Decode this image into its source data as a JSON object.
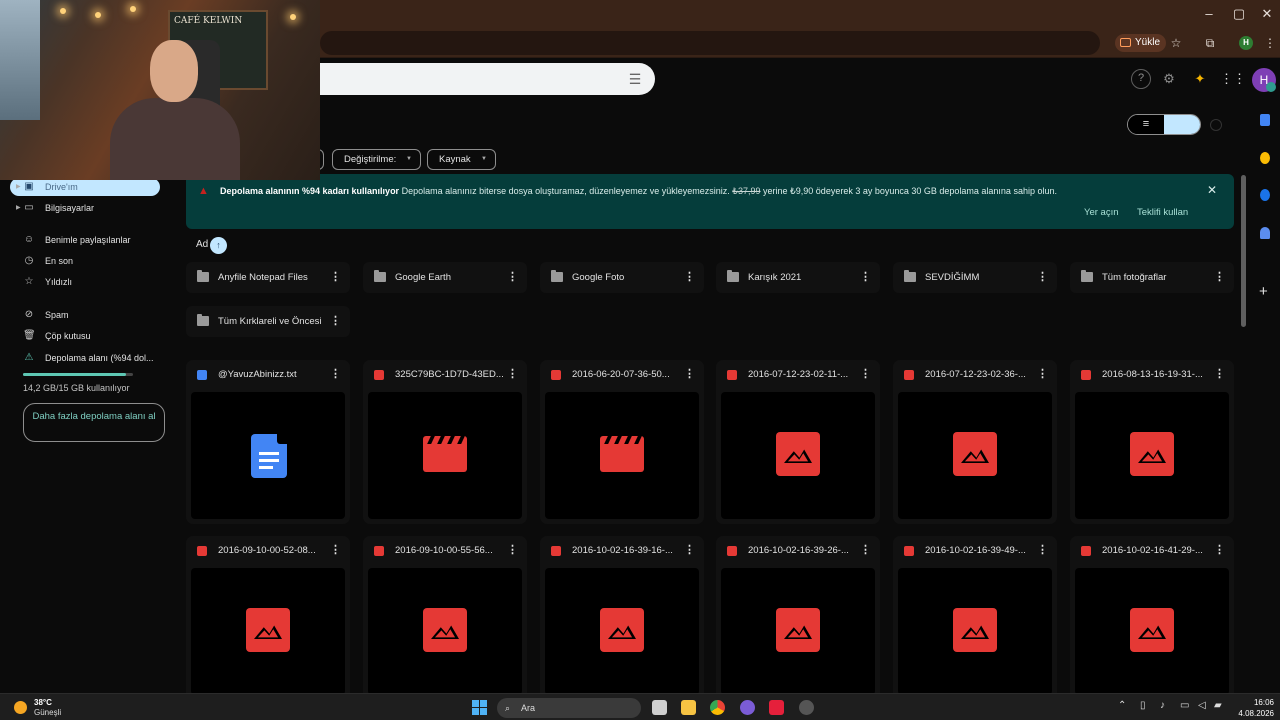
{
  "browser": {
    "upload_chip": "Yükle",
    "profile_letter": "H",
    "window_controls": [
      "–",
      "▢",
      "✕"
    ]
  },
  "header": {
    "avatar_letter": "H"
  },
  "webcam": {
    "sign_text": "CAFÉ KELWIN"
  },
  "sidebar": {
    "items": [
      {
        "label": "Drive'ım",
        "icon": "drive-icon",
        "active": true
      },
      {
        "label": "Bilgisayarlar",
        "icon": "computer-icon"
      },
      {
        "label": "Benimle paylaşılanlar",
        "icon": "shared-icon"
      },
      {
        "label": "En son",
        "icon": "clock-icon"
      },
      {
        "label": "Yıldızlı",
        "icon": "star-icon"
      },
      {
        "label": "Spam",
        "icon": "spam-icon"
      },
      {
        "label": "Çöp kutusu",
        "icon": "trash-icon"
      },
      {
        "label": "Depolama alanı (%94 dol...",
        "icon": "storage-warning-icon"
      }
    ],
    "storage_used_fraction": 0.94,
    "storage_text": "14,2 GB/15 GB kullanılıyor",
    "more_storage_button": "Daha fazla depolama alanı al"
  },
  "filters": {
    "modified": "Değiştirilme:",
    "source": "Kaynak"
  },
  "banner": {
    "bold": "Depolama alanının %94 kadarı kullanılıyor",
    "text": "Depolama alanınız biterse dosya oluşturamaz, düzenleyemez ve yükleyemezsiniz.",
    "old_price": "₺37,99",
    "offer": "yerine ₺9,90 ödeyerek 3 ay boyunca 30 GB depolama alanına sahip olun.",
    "action_free": "Yer açın",
    "action_offer": "Teklifi kullan",
    "accent": "#053d3b"
  },
  "sort": {
    "label": "Ad",
    "arrow": "↑"
  },
  "folders": [
    "Anyfile Notepad Files",
    "Google Earth",
    "Google Foto",
    "Karışık 2021",
    "SEVDİĞİMM",
    "Tüm fotoğraflar",
    "Tüm Kırklareli ve Öncesi"
  ],
  "files": [
    {
      "name": "@YavuzAbinizz.txt",
      "kind": "doc"
    },
    {
      "name": "325C79BC-1D7D-43ED...",
      "kind": "video"
    },
    {
      "name": "2016-06-20-07-36-50...",
      "kind": "video"
    },
    {
      "name": "2016-07-12-23-02-11-...",
      "kind": "image"
    },
    {
      "name": "2016-07-12-23-02-36-...",
      "kind": "image"
    },
    {
      "name": "2016-08-13-16-19-31-...",
      "kind": "image"
    },
    {
      "name": "2016-09-10-00-52-08...",
      "kind": "image"
    },
    {
      "name": "2016-09-10-00-55-56...",
      "kind": "image"
    },
    {
      "name": "2016-10-02-16-39-16-...",
      "kind": "image"
    },
    {
      "name": "2016-10-02-16-39-26-...",
      "kind": "image"
    },
    {
      "name": "2016-10-02-16-39-49-...",
      "kind": "image"
    },
    {
      "name": "2016-10-02-16-41-29-...",
      "kind": "image"
    }
  ],
  "taskbar": {
    "temperature": "38°C",
    "weather": "Güneşli",
    "search": "Ara",
    "time": "16:06",
    "date": "4.08.2026"
  }
}
